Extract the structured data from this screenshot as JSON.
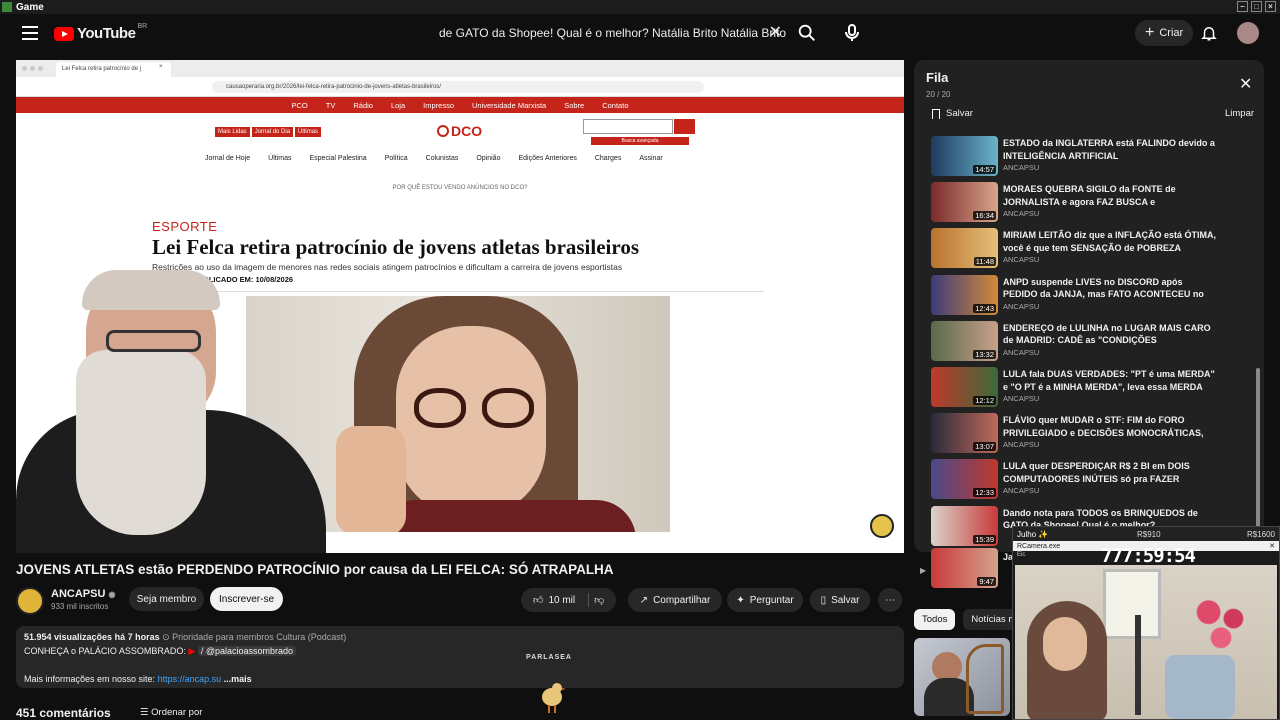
{
  "titlebar": {
    "title": "Game"
  },
  "header": {
    "logo_text": "YouTube",
    "logo_country": "BR",
    "search_value": "de GATO da Shopee! Qual é o melhor? Natália Brito  Natália Brito",
    "create_label": "Criar"
  },
  "player": {
    "browser_tab": "Lei Felca retira patrocínio de j",
    "url": "causaoperaria.org.br/2026/lei-felca-retira-patrocinio-de-jovens-atletas-brasileiros/",
    "site_nav": [
      "PCO",
      "TV",
      "Rádio",
      "Loja",
      "Impresso",
      "Universidade Marxista",
      "Sobre",
      "Contato"
    ],
    "site_buttons": [
      "Mais Lidas",
      "Jornal do Dia",
      "Últimas"
    ],
    "site_logo": "DCO",
    "site_search_adv": "Busca avançada",
    "site_menu": [
      "Jornal de Hoje",
      "Últimas",
      "Especial Palestina",
      "Política",
      "Colunistas",
      "Opinião",
      "Edições Anteriores",
      "Charges",
      "Assinar"
    ],
    "ads_note": "POR QUÊ ESTOU VENDO ANÚNCIOS NO DCO?",
    "article_category": "ESPORTE",
    "article_title": "Lei Felca retira patrocínio de jovens atletas brasileiros",
    "article_subtitle": "Restrições ao uso da imagem de menores nas redes sociais atingem patrocínios e dificultam a carreira de jovens esportistas",
    "article_date": "PUBLICADO EM: 10/08/2026"
  },
  "video": {
    "title": "JOVENS ATLETAS estão PERDENDO PATROCÍNIO por causa da LEI FELCA: SÓ ATRAPALHA",
    "channel": "ANCAPSU",
    "subscribers": "933 mil inscritos",
    "join_label": "Seja membro",
    "subscribe_label": "Inscrever-se",
    "likes": "10 mil",
    "share_label": "Compartilhar",
    "ask_label": "Perguntar",
    "save_label": "Salvar",
    "views": "51.954 visualizações",
    "age": "há 7 horas",
    "members_label": "Prioridade para membros",
    "category": "Cultura (Podcast)",
    "desc_line2": "CONHEÇA o PALÁCIO ASSOMBRADO:",
    "desc_line2_handle": "/ @palacioassombrado",
    "desc_line3": "Mais informações em nosso site:",
    "desc_link": "https://ancap.su",
    "more_label": "...mais",
    "comments_count": "451 comentários",
    "sort_label": "Ordenar por"
  },
  "overlay_game": {
    "pause_label": "PARLASEA"
  },
  "queue": {
    "title": "Fila",
    "count": "20 / 20",
    "save_label": "Salvar",
    "clear_label": "Limpar",
    "items": [
      {
        "title": "ESTADO da INGLATERRA está FALINDO devido a INTELIGÊNCIA ARTIFICIAL",
        "channel": "ANCAPSU",
        "duration": "14:57"
      },
      {
        "title": "MORAES QUEBRA SIGILO da FONTE de JORNALISTA e agora FAZ BUSCA e APREENSÃO...",
        "channel": "ANCAPSU",
        "duration": "16:34"
      },
      {
        "title": "MIRIAM LEITÃO diz que a INFLAÇÃO está ÓTIMA, você é que tem SENSAÇÃO de POBREZA",
        "channel": "ANCAPSU",
        "duration": "11:48"
      },
      {
        "title": "ANPD suspende LIVES no DISCORD após PEDIDO da JANJA, mas FATO ACONTECEU no INSTAGRAM",
        "channel": "ANCAPSU",
        "duration": "12:43"
      },
      {
        "title": "ENDEREÇO de LULINHA no LUGAR MAIS CARO de MADRID: CADÊ as \"CONDIÇÕES PRECÁRIAS\"?",
        "channel": "ANCAPSU",
        "duration": "13:32"
      },
      {
        "title": "LULA fala DUAS VERDADES: \"PT é uma MERDA\" e \"O PT é a MINHA MERDA\", leva essa MERDA pra...",
        "channel": "ANCAPSU",
        "duration": "12:12"
      },
      {
        "title": "FLÁVIO quer MUDAR o STF: FIM do FORO PRIVILEGIADO e DECISÕES MONOCRÁTICAS, ma...",
        "channel": "ANCAPSU",
        "duration": "13:07"
      },
      {
        "title": "LULA quer DESPERDIÇAR R$ 2 BI em DOIS COMPUTADORES INÚTEIS só pra FAZER POLÍTICA",
        "channel": "ANCAPSU",
        "duration": "12:33"
      },
      {
        "title": "Dando nota para TODOS os BRINQUEDOS de GATO da Shopee! Qual é o melhor?",
        "channel": "",
        "duration": "15:39"
      }
    ],
    "last_duration": "9:47",
    "last_title": "Ja"
  },
  "chips": [
    "Todos",
    "Notícias m"
  ],
  "stream_overlay": {
    "user": "Julho ✨",
    "level": "R$910",
    "amount": "R$1600",
    "cam_label": "RCamera.exe",
    "file_label": "Eic",
    "timer": "777:59:54"
  },
  "colors": {
    "accent": "#c4241a",
    "yt_red": "#ff0000",
    "bg": "#0f0f0f",
    "link": "#3ea6ff"
  }
}
